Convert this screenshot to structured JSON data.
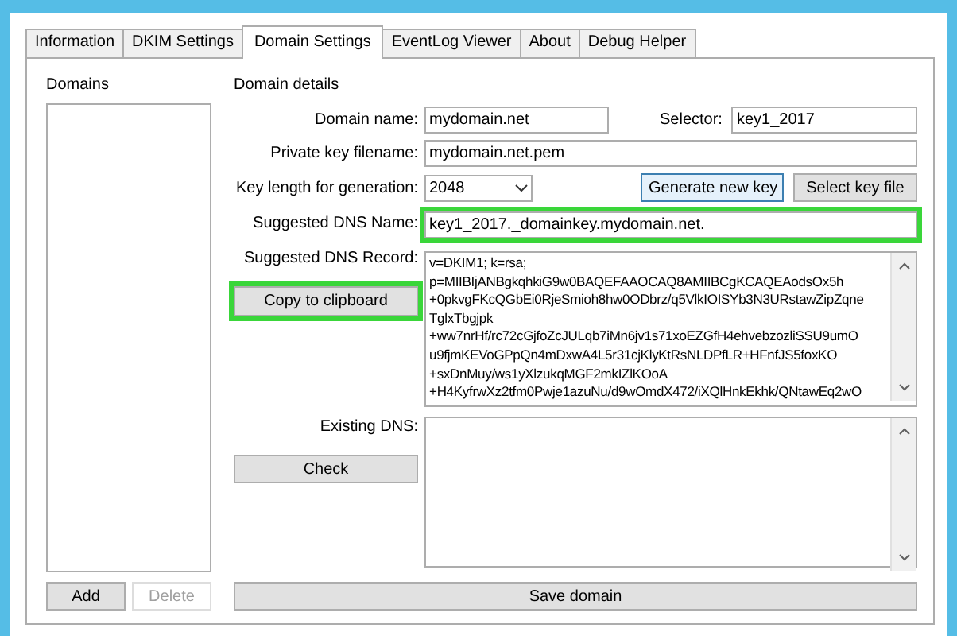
{
  "tabs": [
    {
      "label": "Information",
      "selected": false
    },
    {
      "label": "DKIM Settings",
      "selected": false
    },
    {
      "label": "Domain Settings",
      "selected": true
    },
    {
      "label": "EventLog Viewer",
      "selected": false
    },
    {
      "label": "About",
      "selected": false
    },
    {
      "label": "Debug Helper",
      "selected": false
    }
  ],
  "domains_panel": {
    "title": "Domains",
    "buttons": [
      {
        "label": "Add",
        "disabled": false
      },
      {
        "label": "Delete",
        "disabled": true
      }
    ]
  },
  "domain_details": {
    "title": "Domain details",
    "domain_name": {
      "label": "Domain name:",
      "value": "mydomain.net"
    },
    "selector": {
      "label": "Selector:",
      "value": "key1_2017"
    },
    "private_key_filename": {
      "label": "Private key filename:",
      "value": "mydomain.net.pem"
    },
    "key_length": {
      "label": "Key length for generation:",
      "value": "2048"
    },
    "generate_button": {
      "label": "Generate new key",
      "focused": true
    },
    "select_key_button": {
      "label": "Select key file",
      "focused": false
    },
    "suggested_dns_name": {
      "label": "Suggested DNS Name:",
      "value": "key1_2017._domainkey.mydomain.net.",
      "highlighted": true
    },
    "suggested_dns_record": {
      "label": "Suggested DNS Record:",
      "lines": [
        "v=DKIM1; k=rsa;",
        "p=MIIBIjANBgkqhkiG9w0BAQEFAAOCAQ8AMIIBCgKCAQEAodsOx5h",
        "+0pkvgFKcQGbEi0RjeSmioh8hw0ODbrz/q5VlkIOISYb3N3URstawZipZqne",
        "TglxTbgjpk",
        "+ww7nrHf/rc72cGjfoZcJULqb7iMn6jv1s71xoEZGfH4ehvebzozliSSU9umO",
        "u9fjmKEVoGPpQn4mDxwA4L5r31cjKlyKtRsNLDPfLR+HFnfJS5foxKO",
        "+sxDnMuy/ws1yXlzukqMGF2mkIZlKOoA",
        "+H4KyfrwXz2tfm0Pwje1azuNu/d9wOmdX472/iXQlHnkEkhk/QNtawEq2wO"
      ]
    },
    "copy_button": {
      "label": "Copy to clipboard",
      "highlighted": true
    },
    "existing_dns": {
      "label": "Existing DNS:"
    },
    "check_button": {
      "label": "Check"
    },
    "save_button": {
      "label": "Save domain"
    }
  }
}
